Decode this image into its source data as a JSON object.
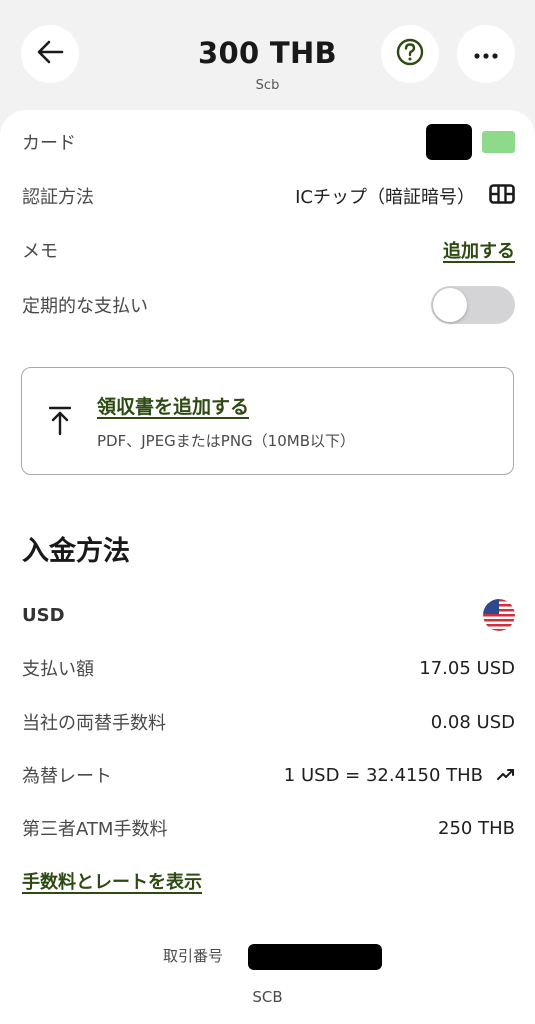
{
  "header": {
    "title": "300 THB",
    "subtitle": "Scb"
  },
  "details": {
    "card_label": "カード",
    "auth_label": "認証方法",
    "auth_value": "ICチップ（暗証暗号）",
    "memo_label": "メモ",
    "memo_action": "追加する",
    "recurring_label": "定期的な支払い",
    "recurring_on": false
  },
  "receipt": {
    "title": "領収書を追加する",
    "hint": "PDF、JPEGまたはPNG（10MB以下）"
  },
  "funding": {
    "section_title": "入金方法",
    "currency": "USD",
    "amount_label": "支払い額",
    "amount_value": "17.05 USD",
    "fx_fee_label": "当社の両替手数料",
    "fx_fee_value": "0.08 USD",
    "rate_label": "為替レート",
    "rate_value": "1 USD = 32.4150 THB",
    "atm_fee_label": "第三者ATM手数料",
    "atm_fee_value": "250 THB",
    "show_fees_link": "手数料とレートを表示"
  },
  "footer": {
    "transaction_label": "取引番号",
    "bank_code": "SCB"
  },
  "colors": {
    "accent_green": "#2d4a12",
    "chip_green": "#8fd98a"
  },
  "icons": [
    "back-arrow-icon",
    "help-icon",
    "more-icon",
    "card-icon",
    "upload-icon",
    "us-flag-icon",
    "trend-icon"
  ]
}
